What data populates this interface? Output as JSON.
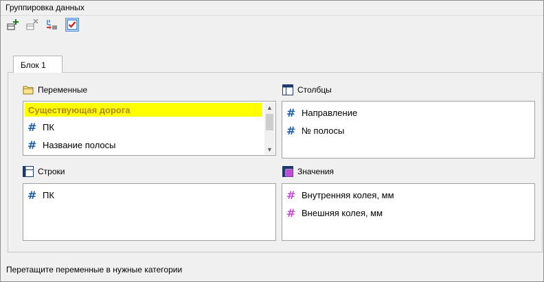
{
  "window": {
    "title": "Группировка данных"
  },
  "toolbar": {
    "buttons": [
      {
        "icon": "add-block-icon"
      },
      {
        "icon": "remove-block-icon"
      },
      {
        "icon": "sort-icon"
      },
      {
        "icon": "checkbox-checked-icon",
        "pressed": true
      }
    ]
  },
  "tabs": [
    {
      "label": "Блок 1",
      "active": true
    }
  ],
  "sections": {
    "variables": {
      "label": "Переменные",
      "selected_item": "Существующая дорога",
      "items": [
        "ПК",
        "Название полосы"
      ]
    },
    "columns": {
      "label": "Столбцы",
      "items": [
        "Направление",
        "№ полосы"
      ]
    },
    "rows": {
      "label": "Строки",
      "items": [
        "ПК"
      ]
    },
    "values": {
      "label": "Значения",
      "items": [
        "Внутренняя колея, мм",
        "Внешняя колея, мм"
      ]
    }
  },
  "status": {
    "text": "Перетащите переменные в нужные категории"
  },
  "colors": {
    "selection": "#ffff00",
    "selection_text": "#b5851f",
    "hash_blue": "#1f5fa8",
    "hash_pink": "#c44dd6",
    "accent": "#1e6fd0"
  }
}
